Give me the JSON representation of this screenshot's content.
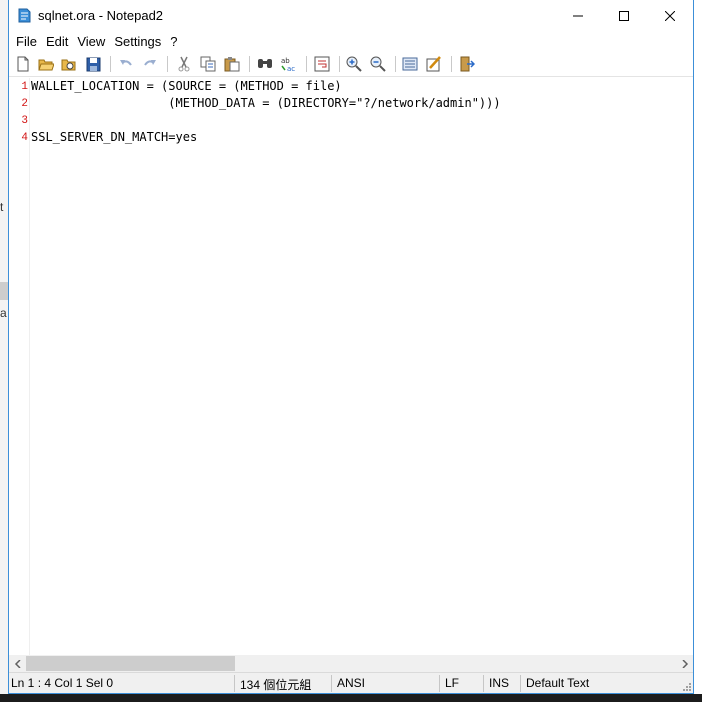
{
  "window": {
    "title": "sqlnet.ora - Notepad2"
  },
  "menu": [
    "File",
    "Edit",
    "View",
    "Settings",
    "?"
  ],
  "toolbar": {
    "buttons": [
      "new-file-icon",
      "open-folder-icon",
      "browse-icon",
      "save-icon",
      "undo-icon",
      "redo-icon",
      "cut-icon",
      "copy-icon",
      "paste-icon",
      "find-icon",
      "replace-icon",
      "word-wrap-icon",
      "zoom-in-icon",
      "zoom-out-icon",
      "view-options-icon",
      "scheme-icon",
      "exit-icon"
    ]
  },
  "editor": {
    "line_numbers": [
      "1",
      "2",
      "3",
      "4"
    ],
    "lines": [
      "WALLET_LOCATION = (SOURCE = (METHOD = file)",
      "                   (METHOD_DATA = (DIRECTORY=\"?/network/admin\")))",
      "",
      "SSL_SERVER_DN_MATCH=yes"
    ]
  },
  "status": {
    "position": "Ln 1 : 4   Col 1   Sel 0",
    "size": "134 個位元組",
    "encoding": "ANSI",
    "line_ending": "LF",
    "insert_mode": "INS",
    "scheme": "Default Text"
  },
  "background": {
    "fragment_1": "t",
    "fragment_2": "a"
  },
  "colors": {
    "line_number": "#d21414",
    "window_border": "#3c8fd8"
  }
}
